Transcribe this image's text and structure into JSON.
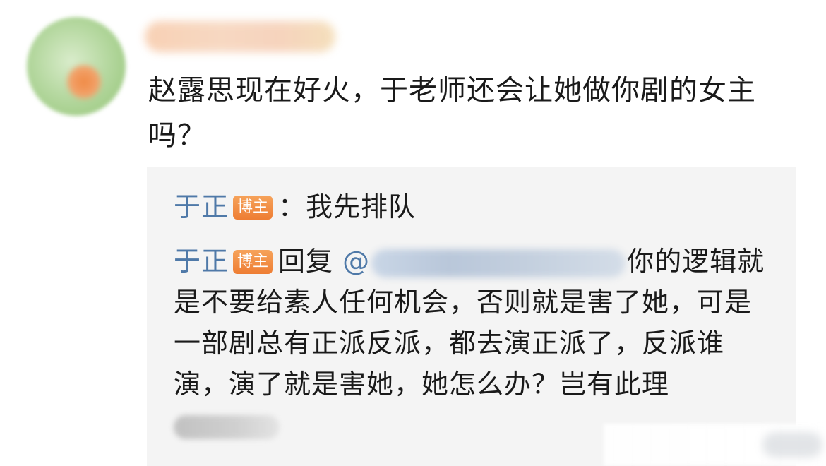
{
  "comment": {
    "text": "赵露思现在好火，于老师还会让她做你剧的女主吗？"
  },
  "replies": [
    {
      "author": "于正",
      "badge": "博主",
      "separator": "：",
      "text": "我先排队"
    },
    {
      "author": "于正",
      "badge": "博主",
      "prefix": "回复",
      "mention_symbol": "@",
      "text": "你的逻辑就是不要给素人任何机会，否则就是害了她，可是一部剧总有正派反派，都去演正派了，反派谁演，演了就是害她，她怎么办？岂有此理"
    }
  ],
  "colors": {
    "author": "#4f79a8",
    "badge": "#ee7d33",
    "reply_bg": "#f4f4f4",
    "text": "#1a1a1a"
  }
}
